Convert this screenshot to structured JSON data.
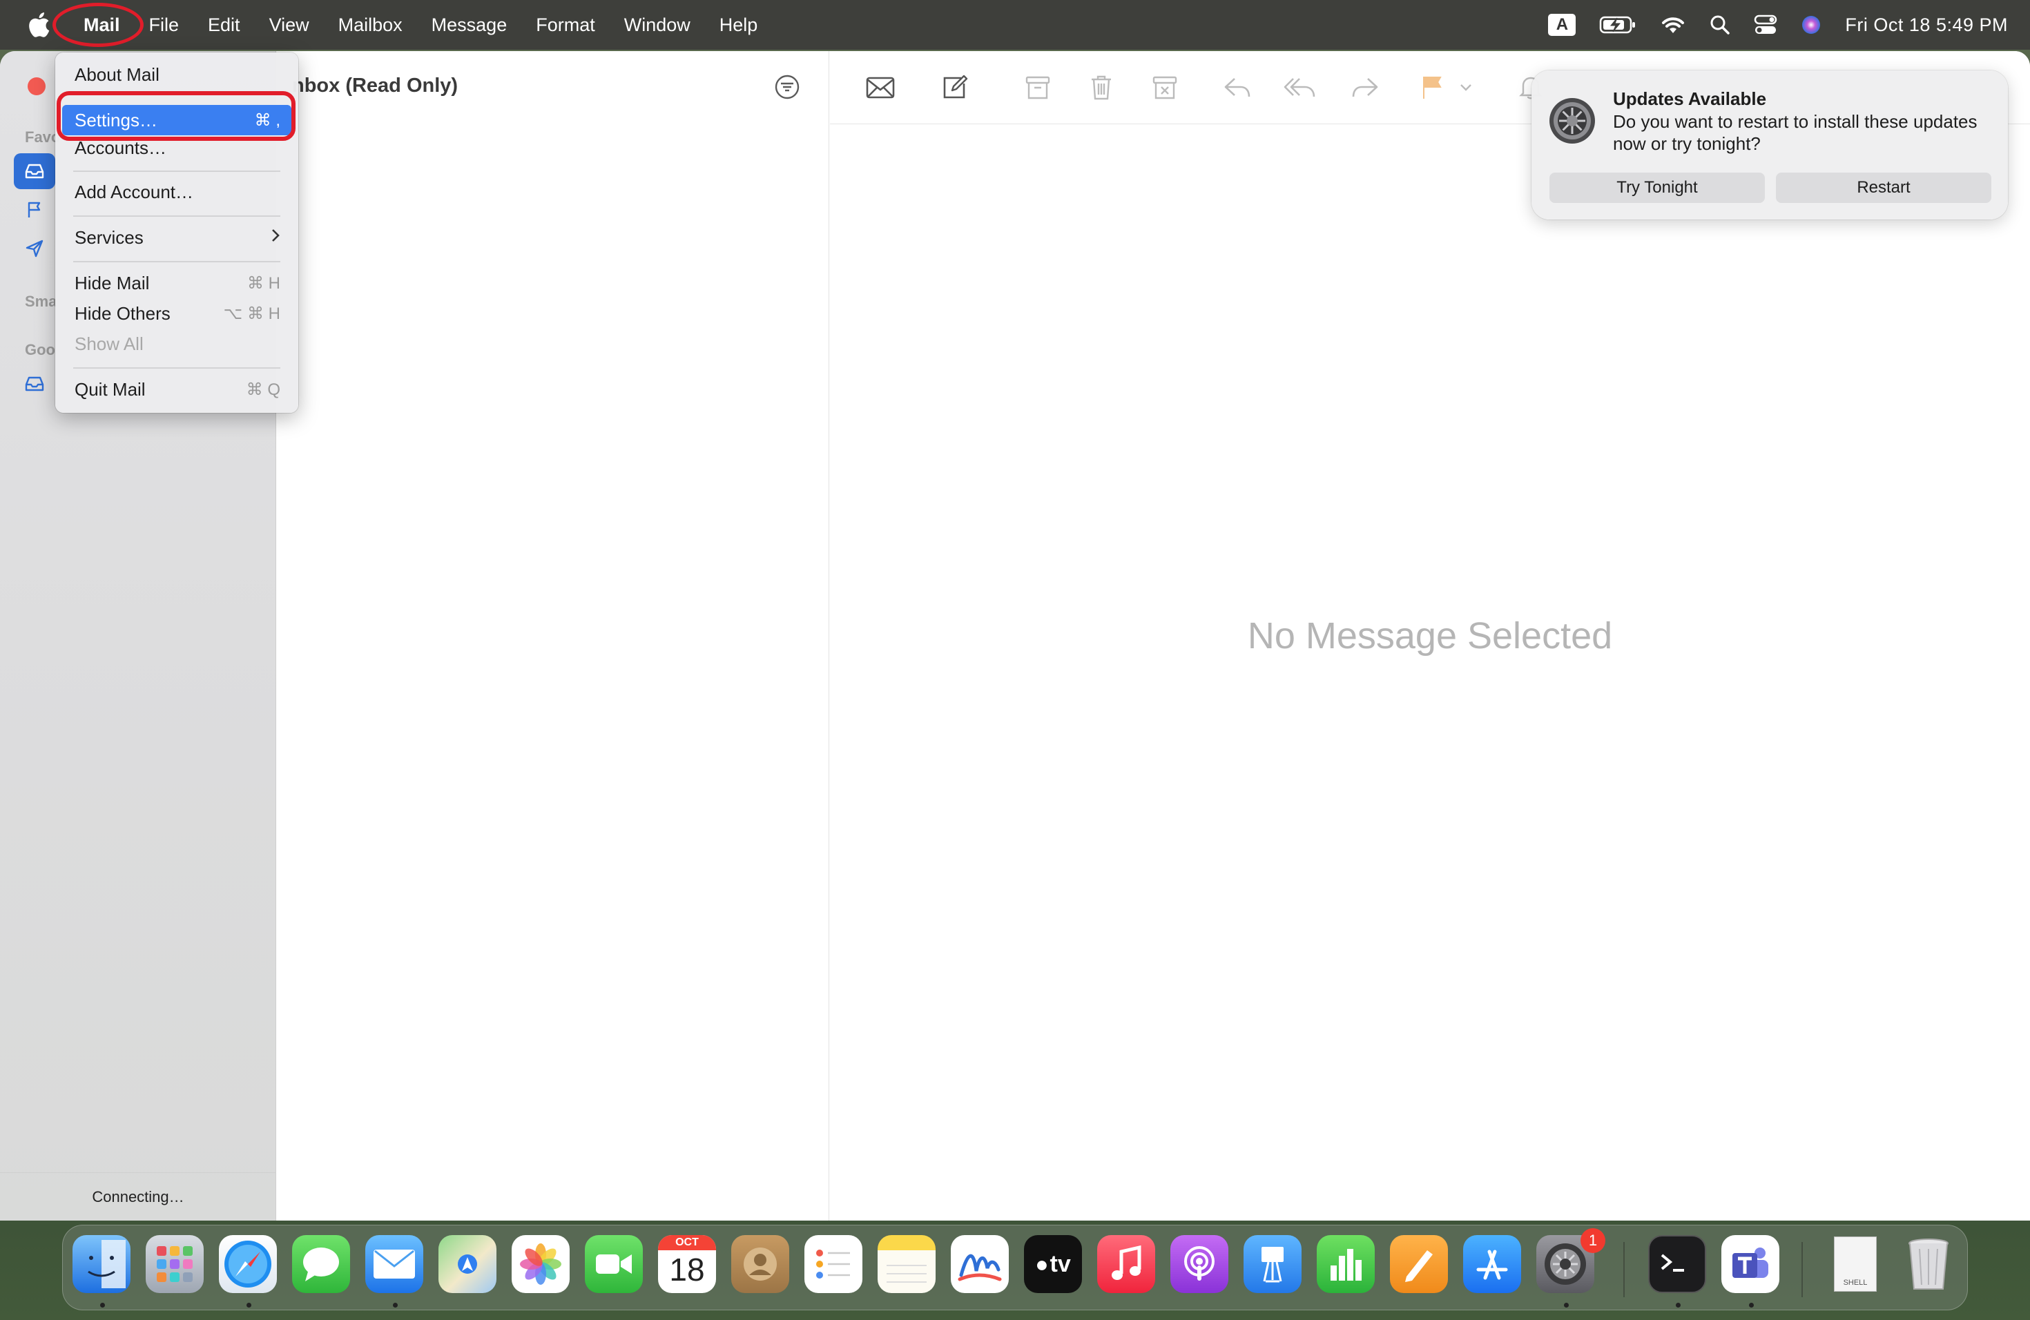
{
  "menubar": {
    "app_name": "Mail",
    "items": [
      "File",
      "Edit",
      "View",
      "Mailbox",
      "Message",
      "Format",
      "Window",
      "Help"
    ],
    "input_source": "A",
    "clock": "Fri Oct 18  5:49 PM"
  },
  "app_menu": {
    "about": "About Mail",
    "settings": "Settings…",
    "settings_shortcut": "⌘ ,",
    "accounts": "Accounts…",
    "add_account": "Add Account…",
    "services": "Services",
    "hide_mail": "Hide Mail",
    "hide_mail_shortcut": "⌘ H",
    "hide_others": "Hide Others",
    "hide_others_shortcut": "⌥ ⌘ H",
    "show_all": "Show All",
    "quit": "Quit Mail",
    "quit_shortcut": "⌘ Q"
  },
  "sidebar": {
    "heading_favorites": "Favo",
    "heading_smart": "Sma",
    "heading_google": "Goo",
    "status": "Connecting…"
  },
  "message_list": {
    "title": "nbox (Read Only)"
  },
  "detail": {
    "empty_text": "No Message Selected"
  },
  "notification": {
    "title": "Updates Available",
    "body": "Do you want to restart to install these updates now or try tonight?",
    "btn_later": "Try Tonight",
    "btn_restart": "Restart"
  },
  "dock": {
    "calendar_month": "OCT",
    "calendar_day": "18",
    "tv_label": "tv",
    "settings_badge": "1",
    "shell_label": "SHELL"
  },
  "colors": {
    "accent": "#3a7ff1",
    "annotation_red": "#e11d2a"
  }
}
